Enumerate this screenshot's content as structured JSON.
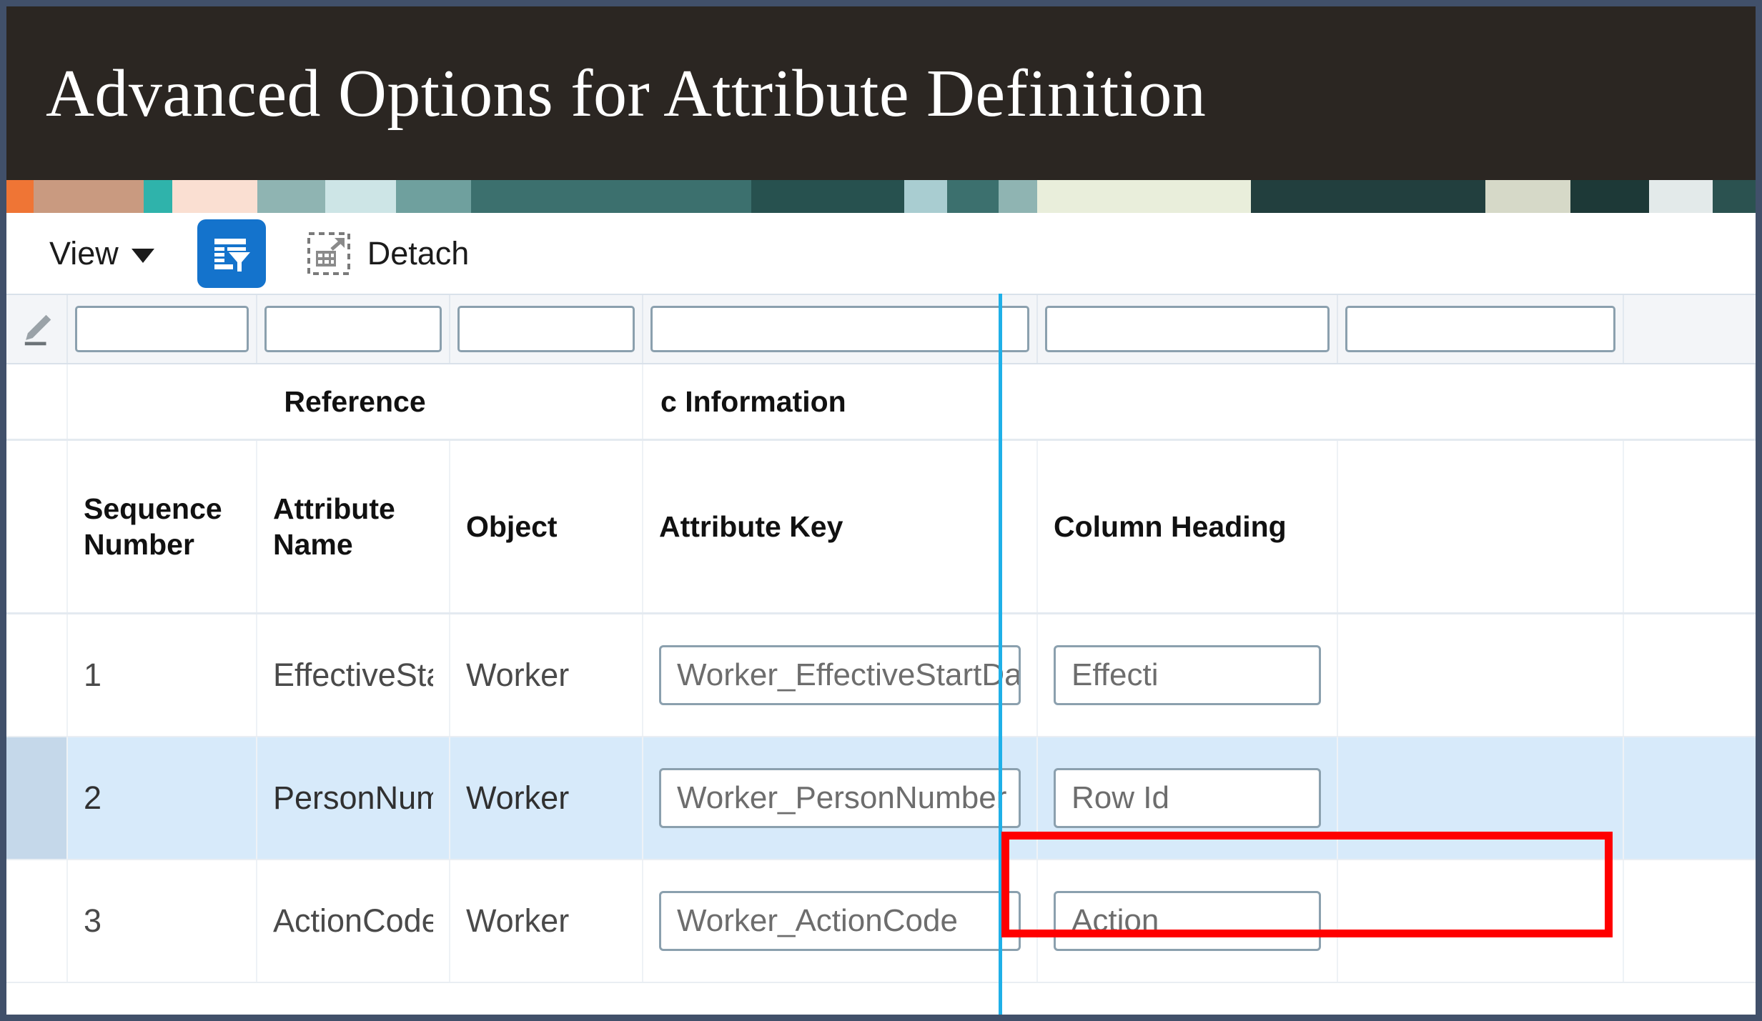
{
  "window": {
    "title": "Advanced Options for Attribute Definition",
    "border_color": "#41506a",
    "title_bg": "#2b2622"
  },
  "banner": {
    "name": "decorative-image-strip",
    "colors": [
      "#ef7535",
      "#c99a80",
      "#2fb3ab",
      "#fadfd2",
      "#8fb4b2",
      "#cde5e6",
      "#3c706e",
      "#2f615f",
      "#27514f",
      "#e9eedb",
      "#223f3e",
      "#1d3937"
    ]
  },
  "toolbar": {
    "view_label": "View",
    "view_caret": "chevron-down-icon",
    "query_by_example_icon": "table-filter-icon",
    "query_by_example_color": "#1473cc",
    "detach_icon": "detach-icon",
    "detach_label": "Detach"
  },
  "table": {
    "handle_icon": "pen-edit-icon",
    "splitter_color": "#1fb0e8",
    "selected_row_color": "#d7eafa",
    "highlight_box_color": "#ff0000",
    "group_headers": [
      {
        "label": "Reference"
      },
      {
        "label": "c Information"
      }
    ],
    "columns": [
      {
        "key": "sequence_number",
        "label": "Sequence Number"
      },
      {
        "key": "attribute_name",
        "label": "Attribute Name"
      },
      {
        "key": "object",
        "label": "Object"
      },
      {
        "key": "attribute_key",
        "label": "Attribute Key"
      },
      {
        "key": "column_heading",
        "label": "Column Heading"
      }
    ],
    "filters": [
      {
        "value": "",
        "placeholder": ""
      },
      {
        "value": "",
        "placeholder": ""
      },
      {
        "value": "",
        "placeholder": ""
      },
      {
        "value": "",
        "placeholder": ""
      },
      {
        "value": "",
        "placeholder": ""
      },
      {
        "value": "",
        "placeholder": ""
      }
    ],
    "rows": [
      {
        "sequence_number": "1",
        "attribute_name": "EffectiveStart…",
        "object": "Worker",
        "attribute_key": "Worker_EffectiveStartDate",
        "column_heading": "Effecti",
        "selected": false,
        "highlighted_cell": null
      },
      {
        "sequence_number": "2",
        "attribute_name": "PersonNumber",
        "object": "Worker",
        "attribute_key": "Worker_PersonNumber",
        "column_heading": "Row Id",
        "selected": true,
        "highlighted_cell": "attribute_key"
      },
      {
        "sequence_number": "3",
        "attribute_name": "ActionCode",
        "object": "Worker",
        "attribute_key": "Worker_ActionCode",
        "column_heading": "Action",
        "selected": false,
        "highlighted_cell": null
      }
    ]
  }
}
